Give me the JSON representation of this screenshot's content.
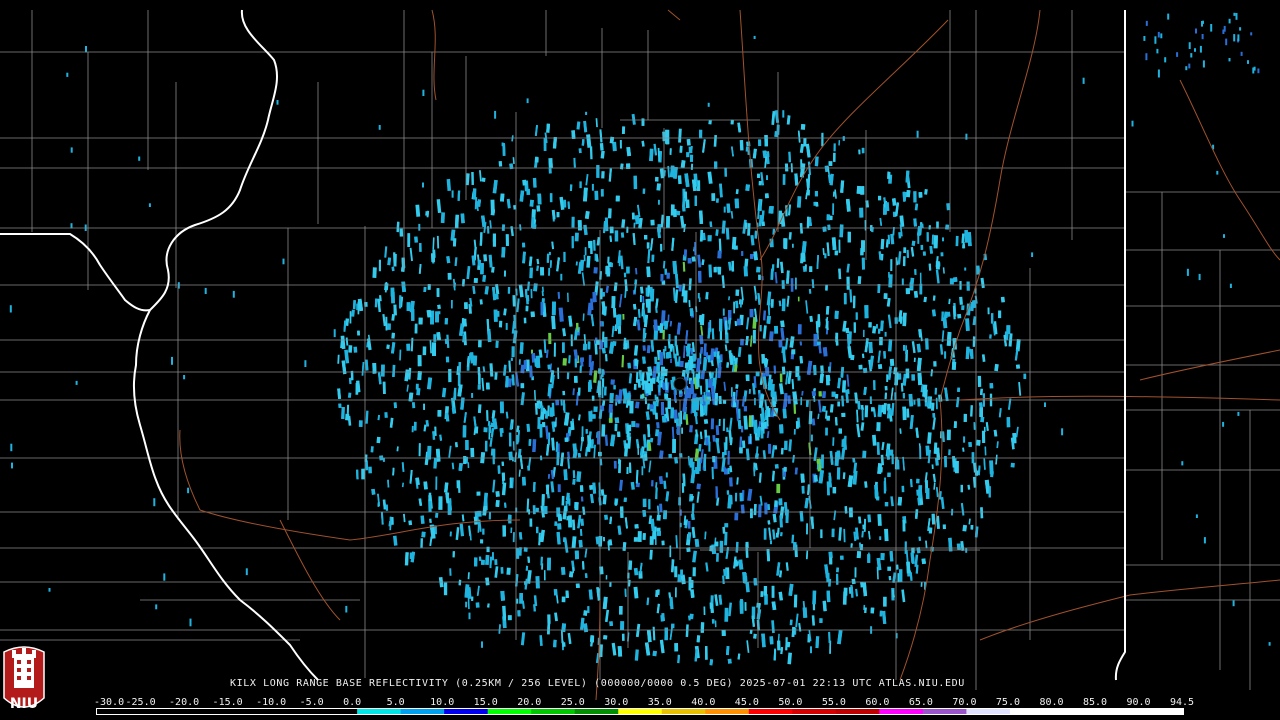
{
  "caption": "KILX LONG RANGE BASE REFLECTIVITY (0.25KM / 256 LEVEL) (000000/0000 0.5 DEG) 2025-07-01 22:13 UTC  ATLAS.NIU.EDU",
  "logo_text": "NIU",
  "scale": {
    "labels": [
      "-30.0",
      "-25.0",
      "-20.0",
      "-15.0",
      "-10.0",
      "-5.0",
      "0.0",
      "5.0",
      "10.0",
      "15.0",
      "20.0",
      "25.0",
      "30.0",
      "35.0",
      "40.0",
      "45.0",
      "50.0",
      "55.0",
      "60.0",
      "65.0",
      "70.0",
      "75.0",
      "80.0",
      "85.0",
      "90.0",
      "94.5"
    ],
    "colors": [
      "#000000",
      "#000000",
      "#000000",
      "#000000",
      "#000000",
      "#000000",
      "#00e5e5",
      "#00a0f0",
      "#0000f0",
      "#00ff00",
      "#00c800",
      "#009000",
      "#ffff00",
      "#e7c000",
      "#ff9000",
      "#ff0000",
      "#d60000",
      "#c00000",
      "#ff00ff",
      "#9955c9",
      "#e0e0ff",
      "#ffffff",
      "#ffffff",
      "#ffffff",
      "#ffffff"
    ]
  },
  "colors": {
    "background": "#000000",
    "county_lines": "#8a8a8a",
    "state_lines": "#ffffff",
    "roads": "#a0522d",
    "echo_primary": "#1fb4e0",
    "echo_secondary": "#33ccee",
    "echo_dense": "#2a6fd8",
    "echo_green": "#66cc44"
  },
  "icons": {
    "logo": "niu-tower-logo",
    "radar_site": "radar-site-marker"
  }
}
